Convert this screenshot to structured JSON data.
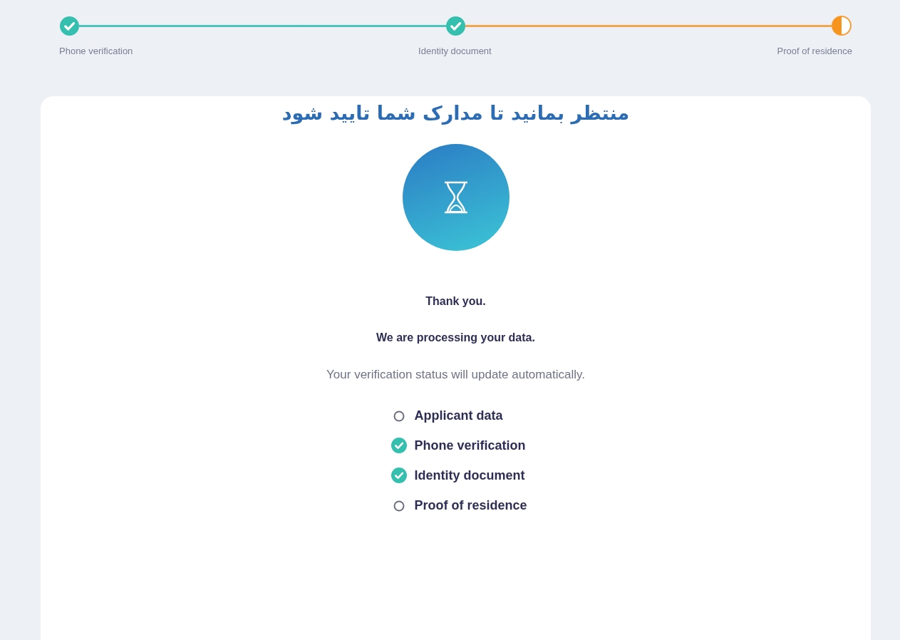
{
  "stepper": [
    {
      "label": "Phone verification",
      "completed": true
    },
    {
      "label": "Identity document",
      "completed": true
    },
    {
      "label": "Proof of residence",
      "completed": false
    }
  ],
  "card": {
    "title": "منتظر بمانید تا مدارک شما تایید شود",
    "thanks": "Thank you.",
    "processing": "We are processing your data.",
    "note": "Your verification status will update automatically.",
    "checklist": [
      {
        "label": "Applicant data",
        "checked": false
      },
      {
        "label": "Phone verification",
        "checked": true
      },
      {
        "label": "Identity document",
        "checked": true
      },
      {
        "label": "Proof of residence",
        "checked": false
      }
    ]
  }
}
